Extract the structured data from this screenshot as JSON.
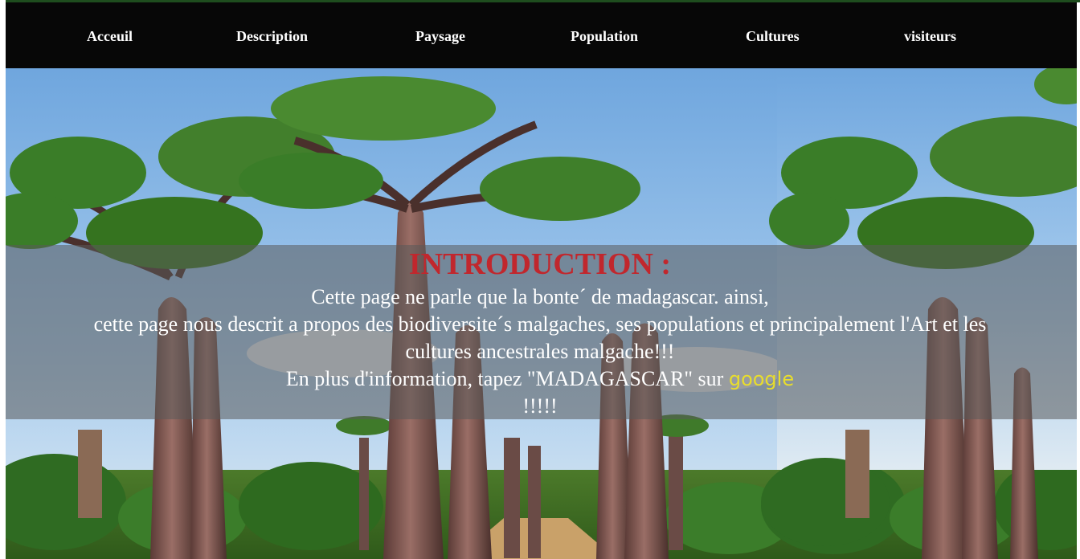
{
  "nav": {
    "items": [
      {
        "label": "Acceuil"
      },
      {
        "label": "Description"
      },
      {
        "label": "Paysage"
      },
      {
        "label": "Population"
      },
      {
        "label": "Cultures"
      },
      {
        "label": "visiteurs"
      }
    ]
  },
  "intro": {
    "title": "INTRODUCTION :",
    "line1": "Cette page ne parle que la bonte´ de madagascar. ainsi,",
    "line2": "cette page nous descrit a propos des biodiversite´s malgaches, ses populations et principalement l'Art et les",
    "line3": "cultures ancestrales malgache!!!",
    "line4_prefix": "En plus d'information, tapez \"MADAGASCAR\" sur",
    "google_link": "google",
    "line5": "!!!!!"
  },
  "colors": {
    "navbar_bg": "#070707",
    "title_red": "#c1272d",
    "link_yellow": "#e8dd2c"
  },
  "hero_image": "baobab-avenue-photo"
}
